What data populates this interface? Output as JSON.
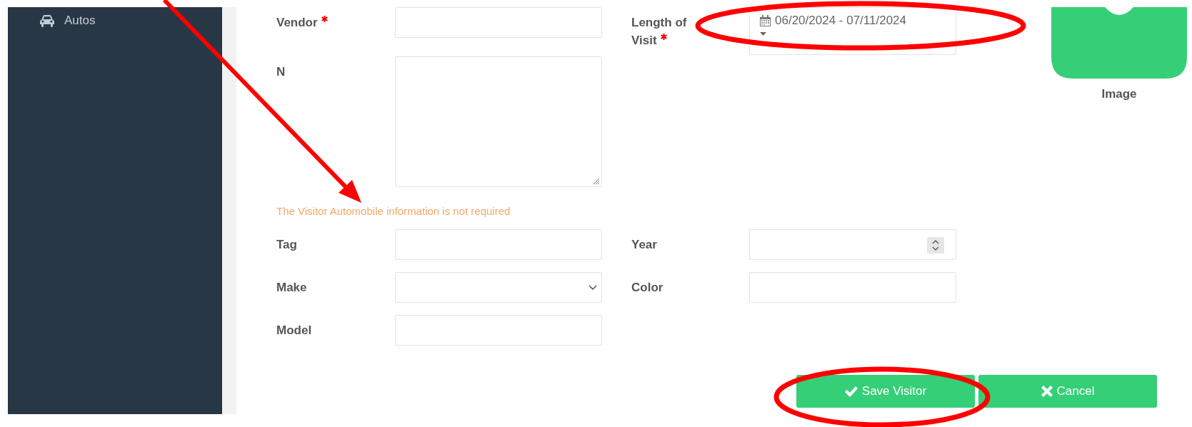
{
  "sidebar": {
    "items": [
      {
        "label": "Autos"
      }
    ]
  },
  "form": {
    "rows": [
      {
        "cells": [
          {
            "label": "Vendor",
            "required": true,
            "kind": "text"
          },
          {
            "label": "Length of\nVisit",
            "required": true,
            "kind": "daterange",
            "value": "06/20/2024 - 07/11/2024"
          }
        ]
      },
      {
        "cells": [
          {
            "label": "N",
            "required": false,
            "kind": "textarea"
          }
        ]
      }
    ],
    "image": {
      "label": "Image"
    },
    "hint": "The Visitor Automobile information is not required",
    "auto_rows": [
      {
        "cells": [
          {
            "label": "Tag",
            "required": false,
            "kind": "text"
          },
          {
            "label": "Year",
            "required": false,
            "kind": "number"
          }
        ]
      },
      {
        "cells": [
          {
            "label": "Make",
            "required": false,
            "kind": "select"
          },
          {
            "label": "Color",
            "required": false,
            "kind": "text"
          }
        ]
      },
      {
        "cells": [
          {
            "label": "Model",
            "required": false,
            "kind": "text"
          }
        ]
      }
    ],
    "buttons": [
      {
        "label": "Save Visitor"
      },
      {
        "label": "Cancel"
      }
    ]
  },
  "annotations": [
    {
      "kind": "arrow"
    },
    {
      "kind": "ellipse"
    },
    {
      "kind": "ellipse"
    }
  ]
}
